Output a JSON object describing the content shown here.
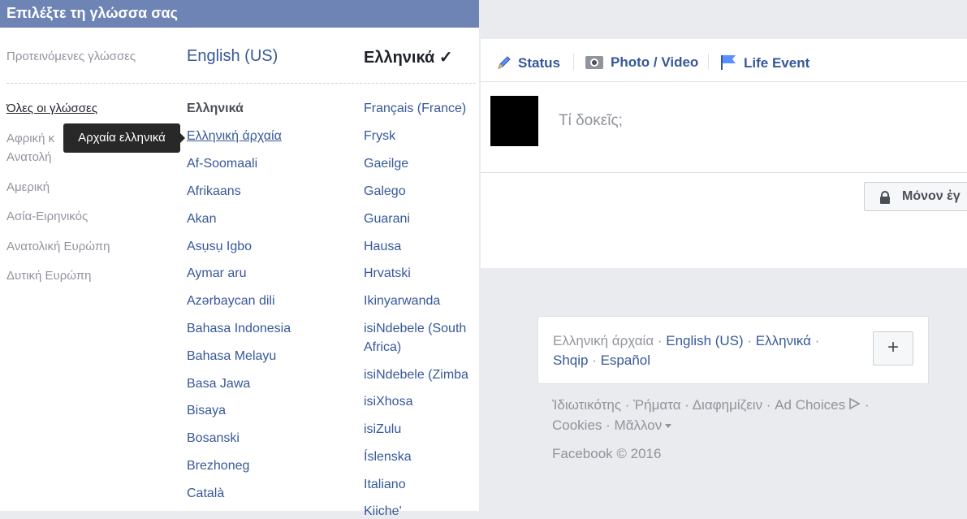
{
  "dialog": {
    "title": "Επιλέξτε τη γλώσσα σας",
    "suggested_label": "Προτεινόμενες γλώσσες",
    "suggested": [
      "English (US)",
      "Ελληνικά ✓"
    ],
    "regions": [
      "Όλες οι γλώσσες",
      "Αφρική κ",
      "Ανατολή",
      "Αμερική",
      "Ασία-Ειρηνικός",
      "Ανατολική Ευρώπη",
      "Δυτική Ευρώπη"
    ],
    "col1": [
      "Ελληνικά",
      "Ελληνική άρχαία",
      "Af-Soomaali",
      "Afrikaans",
      "Akan",
      "Asụsụ Igbo",
      "Aymar aru",
      "Azərbaycan dili",
      "Bahasa Indonesia",
      "Bahasa Melayu",
      "Basa Jawa",
      "Bisaya",
      "Bosanski",
      "Brezhoneg",
      "Català"
    ],
    "col2": [
      "Français (France)",
      "Frysk",
      "Gaeilge",
      "Galego",
      "Guarani",
      "Hausa",
      "Hrvatski",
      "Ikinyarwanda",
      "isiNdebele (South",
      "Africa)",
      "isiNdebele (Zimba",
      "isiXhosa",
      "isiZulu",
      "Íslenska",
      "Italiano",
      "Kiiche'"
    ],
    "tooltip": "Αρχαία ελληνικά"
  },
  "composer": {
    "tabs": [
      "Status",
      "Photo / Video",
      "Life Event"
    ],
    "placeholder": "Τί δοκεῖς;",
    "privacy_label": "Μόνον ἐγ"
  },
  "footer": {
    "languages": [
      "Ελληνική άρχαία",
      "English (US)",
      "Ελληνικά",
      "Shqip",
      "Español"
    ],
    "plus": "+",
    "links": [
      "Ἰδιωτικότης",
      "Ῥήματα",
      "Διαφημίζειν",
      "Ad Choices",
      "Cookies",
      "Μᾶλλον"
    ],
    "copyright": "Facebook © 2016"
  },
  "icons": {
    "status": "pencil-icon",
    "photo": "camera-icon",
    "life_event": "flag-icon",
    "privacy": "lock-icon",
    "ad_choices": "ad-choices-icon",
    "more": "caret-down-icon"
  },
  "colors": {
    "header": "#6d84b4",
    "link": "#365899",
    "muted": "#90949c",
    "page_bg": "#e9ebee"
  }
}
